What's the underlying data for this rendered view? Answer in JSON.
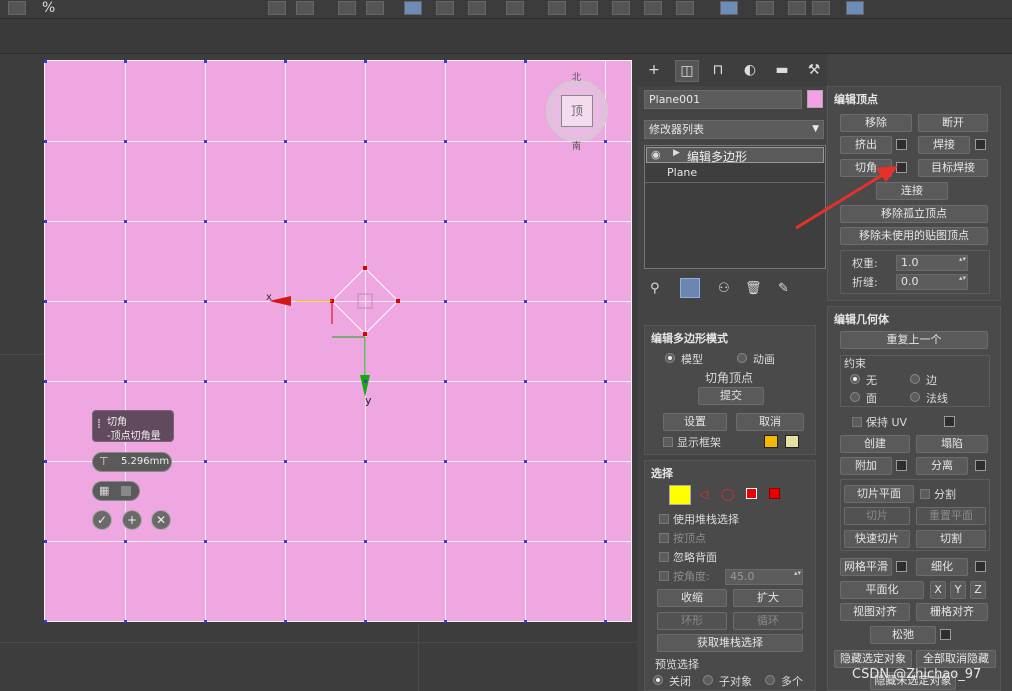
{
  "toolbar": {
    "percent_label": "%"
  },
  "viewport": {
    "axis_x_label": "x",
    "axis_y_label": "y",
    "viewcube_label": "顶",
    "viewcube_n": "北",
    "viewcube_s": "南"
  },
  "caddy": {
    "title": "切角",
    "subtitle": "-顶点切角量",
    "amount_value": "5.296mm"
  },
  "command_panel": {
    "object_name": "Plane001",
    "object_color": "#f4a0e6",
    "modifier_list_label": "修改器列表",
    "stack": {
      "top_item": "编辑多边形",
      "base_item": "Plane"
    },
    "edit_vertices": {
      "title": "编辑顶点",
      "remove": "移除",
      "break": "断开",
      "extrude": "挤出",
      "weld": "焊接",
      "chamfer": "切角",
      "target_weld": "目标焊接",
      "connect": "连接",
      "remove_isolated": "移除孤立顶点",
      "remove_unused_map": "移除未使用的贴图顶点",
      "weight_label": "权重:",
      "weight_value": "1.0",
      "crease_label": "折缝:",
      "crease_value": "0.0"
    },
    "edit_poly_mode": {
      "title": "编辑多边形模式",
      "model": "模型",
      "animate": "动画",
      "current_op": "切角顶点",
      "commit": "提交",
      "settings": "设置",
      "cancel": "取消",
      "show_cage": "显示框架",
      "cage_color_1": "#f5b800",
      "cage_color_2": "#e8e0a0"
    },
    "selection": {
      "title": "选择",
      "use_stack": "使用堆栈选择",
      "by_vertex": "按顶点",
      "ignore_backfacing": "忽略背面",
      "by_angle_label": "按角度:",
      "by_angle_value": "45.0",
      "shrink": "收缩",
      "grow": "扩大",
      "ring": "环形",
      "loop": "循环",
      "get_stack_sel": "获取堆栈选择",
      "preview_label": "预览选择",
      "off": "关闭",
      "subobject": "子对象",
      "multi": "多个"
    },
    "edit_geometry": {
      "title": "编辑几何体",
      "repeat_last": "重复上一个",
      "constraints_label": "约束",
      "none": "无",
      "edge": "边",
      "face": "面",
      "normal": "法线",
      "preserve_uv": "保持 UV",
      "create": "创建",
      "collapse": "塌陷",
      "attach": "附加",
      "detach": "分离",
      "slice_plane": "切片平面",
      "split": "分割",
      "slice": "切片",
      "reset_plane": "重置平面",
      "quickslice": "快速切片",
      "cut": "切割",
      "meshsmooth": "网格平滑",
      "tessellate": "细化",
      "planarize": "平面化",
      "x": "X",
      "y": "Y",
      "z": "Z",
      "view_align": "视图对齐",
      "grid_align": "栅格对齐",
      "relax": "松弛",
      "hide_selected": "隐藏选定对象",
      "unhide_all": "全部取消隐藏",
      "hide_unselected": "隐藏未选定对象"
    }
  },
  "watermark": "CSDN @Zhichao_97"
}
